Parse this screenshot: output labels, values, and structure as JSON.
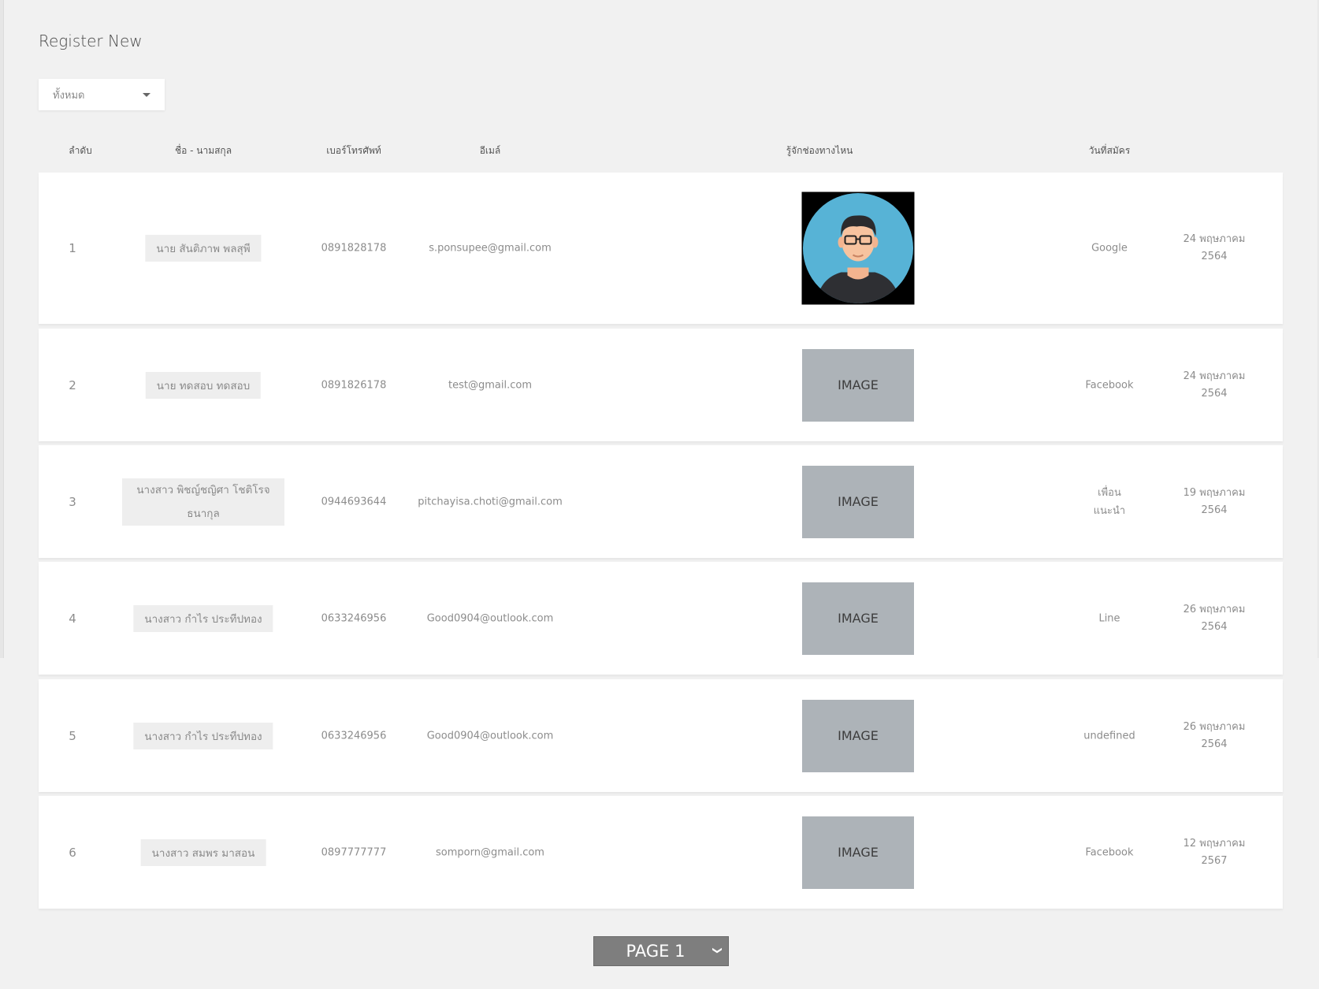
{
  "page_title": "Register New",
  "filter": {
    "selected": "ทั้งหมด"
  },
  "table": {
    "headers": {
      "index": "ลำดับ",
      "name": "ชื่อ - นามสกุล",
      "phone": "เบอร์โทรศัพท์",
      "email": "อีเมล์",
      "image": "รู้จักช่องทางไหน",
      "channel": "วันที่สมัคร"
    },
    "rows": [
      {
        "index": "1",
        "name": "นาย สันติภาพ พลสุพี",
        "phone": "0891828178",
        "email": "s.ponsupee@gmail.com",
        "image": "avatar",
        "channel": "Google",
        "date_day": "24 พฤษภาคม",
        "date_year": "2564"
      },
      {
        "index": "2",
        "name": "นาย ทดสอบ ทดสอบ",
        "phone": "0891826178",
        "email": "test@gmail.com",
        "image": "IMAGE",
        "channel": "Facebook",
        "date_day": "24 พฤษภาคม",
        "date_year": "2564"
      },
      {
        "index": "3",
        "name": "นางสาว พิชญ์ชญิศา โชติโรจ ธนากุล",
        "phone": "0944693644",
        "email": "pitchayisa.choti@gmail.com",
        "image": "IMAGE",
        "channel": "เพื่อน แนะนำ",
        "date_day": "19 พฤษภาคม",
        "date_year": "2564"
      },
      {
        "index": "4",
        "name": "นางสาว กำไร ประทีปทอง",
        "phone": "0633246956",
        "email": "Good0904@outlook.com",
        "image": "IMAGE",
        "channel": "Line",
        "date_day": "26 พฤษภาคม",
        "date_year": "2564"
      },
      {
        "index": "5",
        "name": "นางสาว กำไร ประทีปทอง",
        "phone": "0633246956",
        "email": "Good0904@outlook.com",
        "image": "IMAGE",
        "channel": "undefined",
        "date_day": "26 พฤษภาคม",
        "date_year": "2564"
      },
      {
        "index": "6",
        "name": "นางสาว สมพร มาสอน",
        "phone": "0897777777",
        "email": "somporn@gmail.com",
        "image": "IMAGE",
        "channel": "Facebook",
        "date_day": "12 พฤษภาคม",
        "date_year": "2567"
      }
    ]
  },
  "pagination": {
    "label": "PAGE 1"
  },
  "colors": {
    "background": "#f1f1f1",
    "row_background": "#ffffff",
    "chip_background": "#eeeeee",
    "image_placeholder": "#adb3b8",
    "avatar_circle": "#57b3d6",
    "pager_background": "#7e7e7e"
  }
}
